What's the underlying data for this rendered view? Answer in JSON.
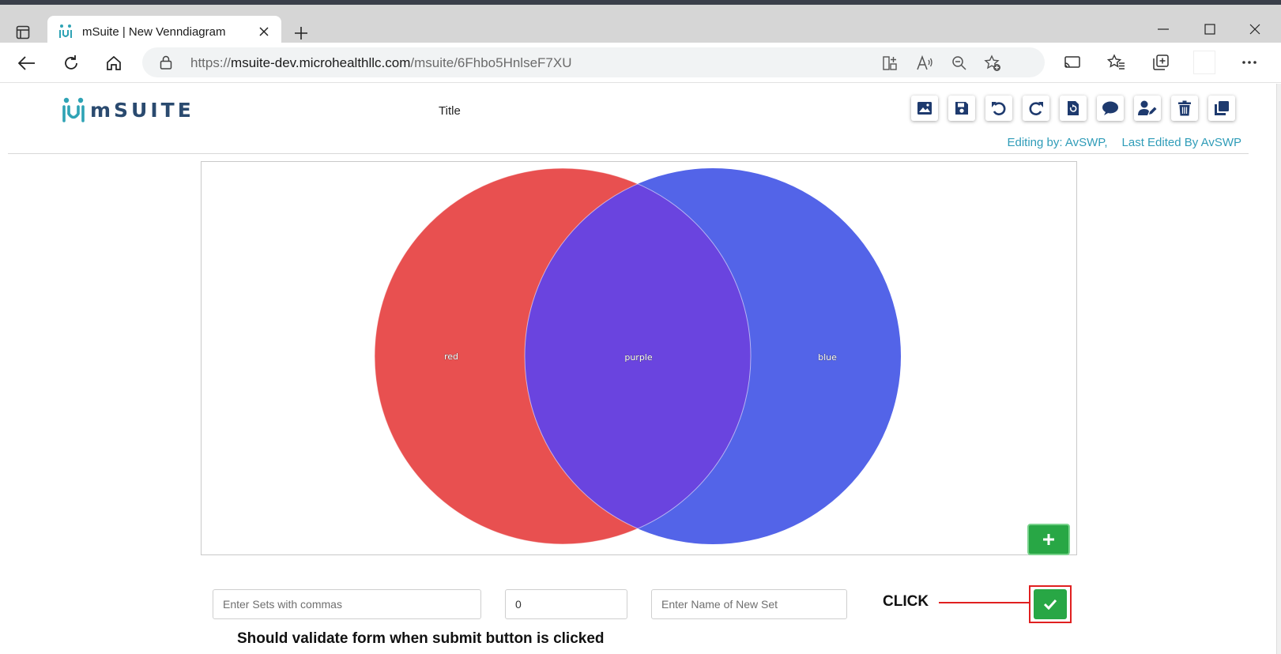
{
  "browser": {
    "tab_title": "mSuite | New Venndiagram",
    "url_scheme": "https://",
    "url_host": "msuite-dev.microhealthllc.com",
    "url_path": "/msuite/6Fhbo5HnlseF7XU",
    "url_icons": [
      "split-screen-icon",
      "read-aloud-icon",
      "zoom-out-icon",
      "add-favorite-icon"
    ],
    "toolbar_icons": [
      "cast-icon",
      "favorites-icon",
      "collections-icon",
      "profile-icon",
      "more-icon"
    ]
  },
  "app": {
    "logo_text": "mSUITE",
    "title": "Title",
    "tools": [
      "image-icon",
      "save-icon",
      "undo-icon",
      "redo-icon",
      "reset-icon",
      "comment-icon",
      "user-edit-icon",
      "trash-icon",
      "copy-icon"
    ],
    "editing_by": "Editing by: AvSWP,",
    "last_edited": "Last Edited By AvSWP"
  },
  "venn": {
    "sets": [
      {
        "label": "red",
        "color": "#e85050"
      },
      {
        "label": "blue",
        "color": "#5364e8"
      }
    ],
    "intersection": {
      "label": "purple",
      "color": "#6a44df"
    }
  },
  "form": {
    "sets_placeholder": "Enter Sets with commas",
    "size_value": "0",
    "name_placeholder": "Enter Name of New Set"
  },
  "annotation": {
    "click_label": "CLICK",
    "caption": "Should validate form when submit button is clicked"
  },
  "colors": {
    "brand_teal": "#2f9cb8",
    "navy": "#1e3a6e",
    "green": "#28a745",
    "annotation_red": "#e02020"
  }
}
